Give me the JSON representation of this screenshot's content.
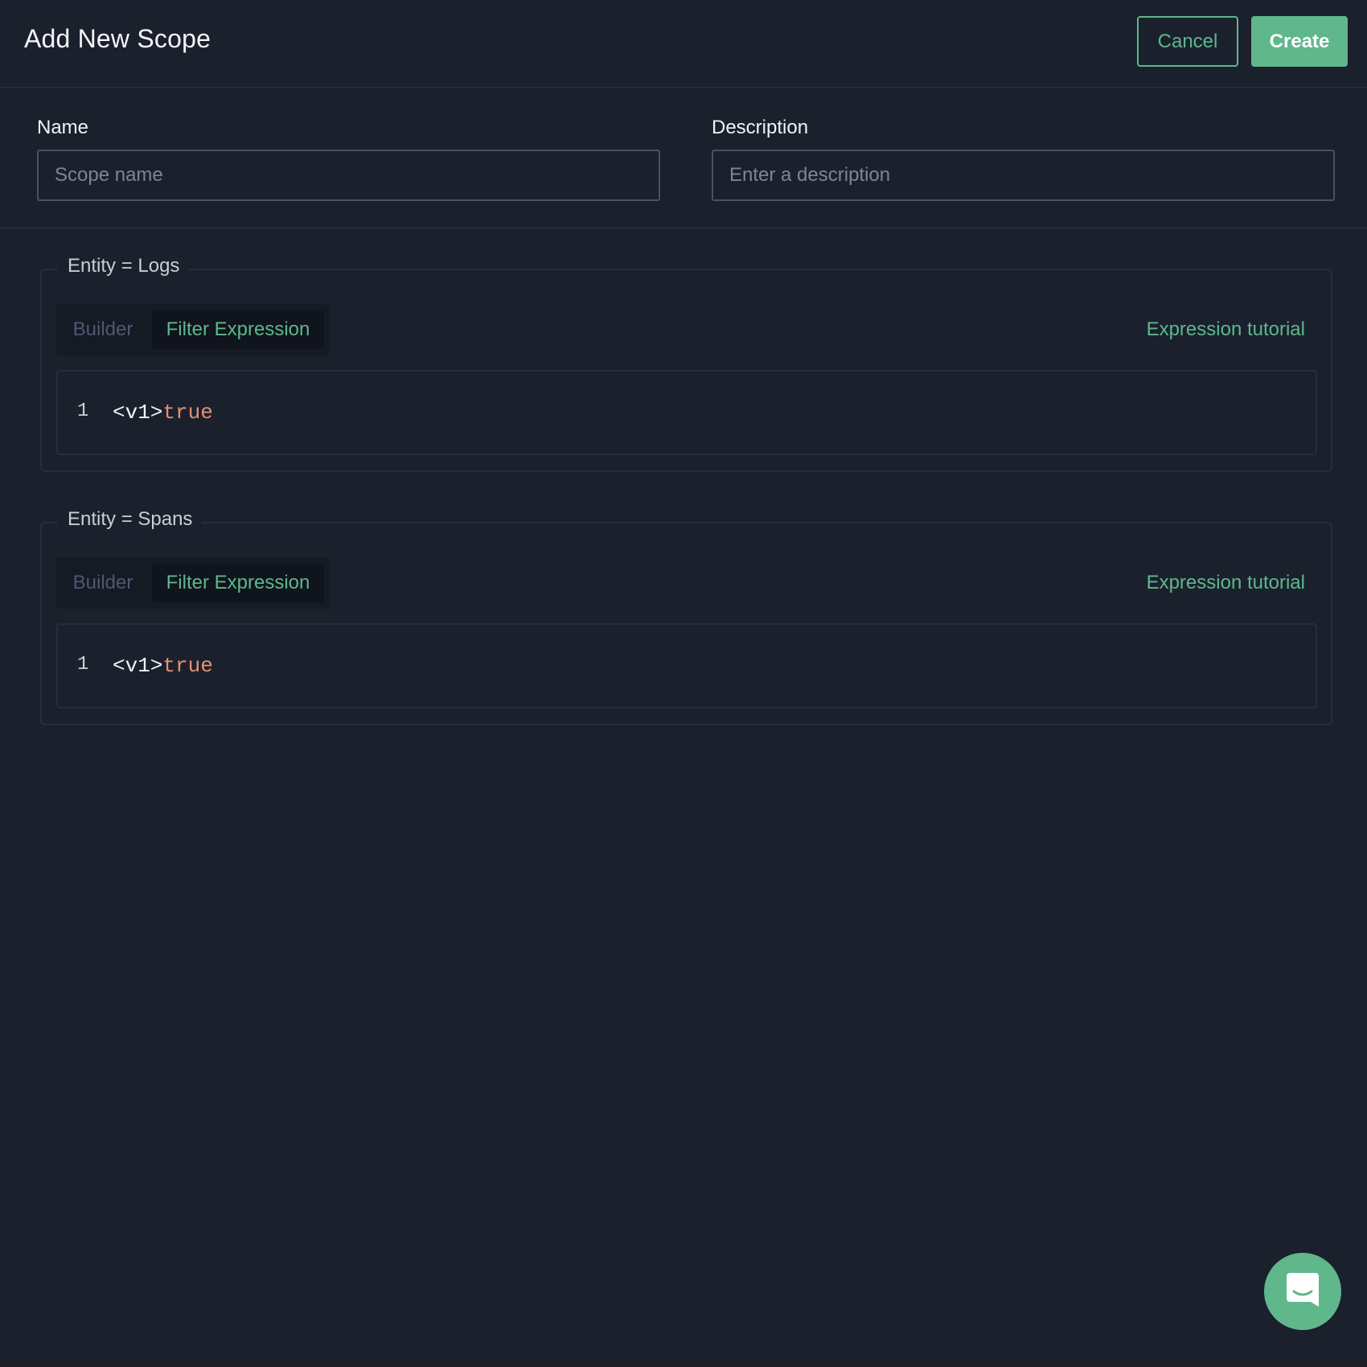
{
  "header": {
    "title": "Add New Scope",
    "cancel_label": "Cancel",
    "create_label": "Create"
  },
  "form": {
    "name": {
      "label": "Name",
      "placeholder": "Scope name",
      "value": ""
    },
    "description": {
      "label": "Description",
      "placeholder": "Enter a description",
      "value": ""
    }
  },
  "entities": [
    {
      "legend": "Entity = Logs",
      "tabs": {
        "builder": "Builder",
        "filter": "Filter Expression",
        "active": "filter"
      },
      "tutorial_label": "Expression tutorial",
      "editor": {
        "line_number": "1",
        "tag": "<v1>",
        "value": "true"
      }
    },
    {
      "legend": "Entity = Spans",
      "tabs": {
        "builder": "Builder",
        "filter": "Filter Expression",
        "active": "filter"
      },
      "tutorial_label": "Expression tutorial",
      "editor": {
        "line_number": "1",
        "tag": "<v1>",
        "value": "true"
      }
    }
  ],
  "chat": {
    "icon": "chat-bubble-icon"
  },
  "colors": {
    "background": "#1b202d",
    "accent": "#5fb78b",
    "code_value": "#e39173",
    "border": "#262d3e"
  }
}
